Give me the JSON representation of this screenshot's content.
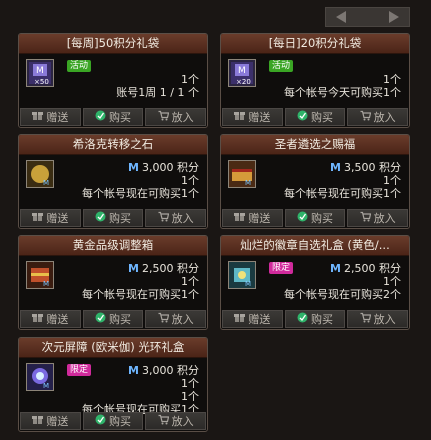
{
  "pager": {
    "prev_icon": "arrow-left-icon",
    "next_icon": "arrow-right-icon"
  },
  "buttons": {
    "gift": "赠送",
    "buy": "购买",
    "cart": "放入"
  },
  "cards": [
    {
      "title": "[每周]50积分礼袋",
      "tag": "活动",
      "tag_color": "green",
      "price": "",
      "l1": "1个",
      "l2": "账号1周 1 / 1 个",
      "l3": "",
      "icon": "box-x50-icon",
      "icon_sub": "×50"
    },
    {
      "title": "[每日]20积分礼袋",
      "tag": "活动",
      "tag_color": "green",
      "price": "",
      "l1": "1个",
      "l2": "每个帐号今天可购买1个",
      "l3": "",
      "icon": "box-x20-icon",
      "icon_sub": "×20"
    },
    {
      "title": "希洛克转移之石",
      "tag": "",
      "tag_color": "",
      "price": "3,000 积分",
      "l1": "1个",
      "l2": "每个帐号现在可购买1个",
      "l3": "",
      "icon": "stone-icon",
      "icon_sub": ""
    },
    {
      "title": "圣者遴选之赐福",
      "tag": "",
      "tag_color": "",
      "price": "3,500 积分",
      "l1": "1个",
      "l2": "每个帐号现在可购买1个",
      "l3": "",
      "icon": "blessing-icon",
      "icon_sub": ""
    },
    {
      "title": "黄金品级调整箱",
      "tag": "",
      "tag_color": "",
      "price": "2,500 积分",
      "l1": "1个",
      "l2": "每个帐号现在可购买1个",
      "l3": "",
      "icon": "gold-box-icon",
      "icon_sub": ""
    },
    {
      "title": "灿烂的徽章自选礼盒 (黄色/...",
      "tag": "限定",
      "tag_color": "pink",
      "price": "2,500 积分",
      "l1": "1个",
      "l2": "每个帐号现在可购买2个",
      "l3": "",
      "icon": "emblem-box-icon",
      "icon_sub": ""
    },
    {
      "title": "次元屏障 (欧米伽) 光环礼盒",
      "tag": "限定",
      "tag_color": "pink",
      "price": "3,000 积分",
      "l1": "1个",
      "l2": "1个",
      "l3": "每个帐号现在可购买1个",
      "icon": "aura-box-icon",
      "icon_sub": ""
    }
  ],
  "price_prefix": "M"
}
